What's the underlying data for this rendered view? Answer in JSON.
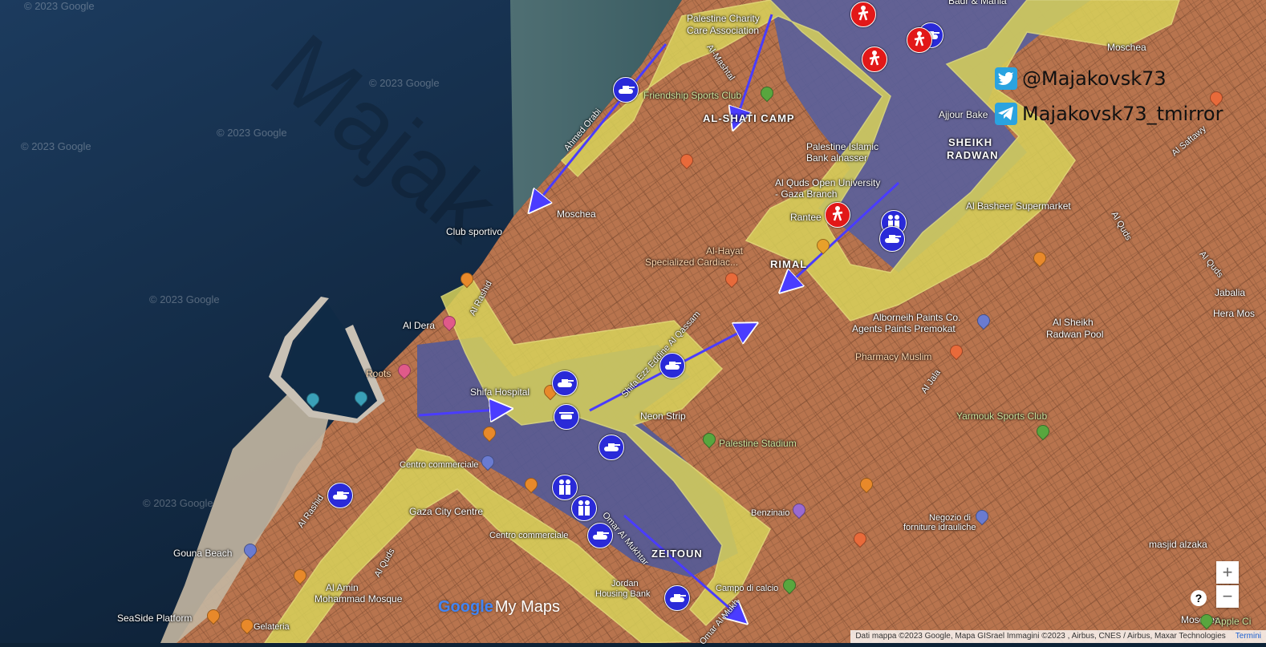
{
  "map": {
    "watermark_text": "© 2023 Google",
    "area_labels": {
      "al_shati_camp": "AL-SHATI CAMP",
      "sheikh_radwan_1": "SHEIKH",
      "sheikh_radwan_2": "RADWAN",
      "rimal": "RIMAL",
      "zeitoun": "ZEITOUN"
    },
    "places": {
      "palestine_charity_1": "Palestine Charity",
      "palestine_charity_2": "Care Association",
      "friendship_sports_club": "Friendship Sports Club",
      "ajjour_bake": "Ajjour Bake",
      "palestine_islamic_1": "Palestine Islamic",
      "palestine_islamic_2": "Bank alnasser",
      "al_quds_open_1": "Al Quds Open University",
      "al_quds_open_2": "- Gaza Branch",
      "rantee": "Rantee",
      "al_basheer": "Al Basheer Supermarket",
      "moschea_1": "Moschea",
      "moschea_2": "Moschea",
      "moschea_3": "Moschea",
      "club_sportivo": "Club sportivo",
      "al_hayat_1": "Al-Hayat",
      "al_hayat_2": "Specialized Cardiac...",
      "al_dera": "Al Dera",
      "roots": "Roots",
      "shifa_hospital": "Shifa Hospital",
      "alborneih_1": "Alborneih Paints Co.",
      "alborneih_2": "Agents Paints Premokat",
      "pharmacy_muslim": "Pharmacy Muslim",
      "al_sheikh_radwan_pool_1": "Al Sheikh",
      "al_sheikh_radwan_pool_2": "Radwan Pool",
      "yarmouk": "Yarmouk Sports Club",
      "neon_strip": "Neon Strip",
      "palestine_stadium": "Palestine Stadium",
      "centro_commerciale_1": "Centro commerciale",
      "centro_commerciale_2": "Centro commerciale",
      "gaza_city_centre": "Gaza City Centre",
      "benzinaio": "Benzinaio",
      "negozio_1": "Negozio di",
      "negozio_2": "forniture idrauliche",
      "masjid_alzaka": "masjid alzaka",
      "gouna_beach": "Gouna Beach",
      "al_amin_1": "Al Amin",
      "al_amin_2": "Mohammad Mosque",
      "jordan_bank_1": "Jordan",
      "jordan_bank_2": "Housing Bank",
      "campo_di_calcio": "Campo di calcio",
      "seaside_platform": "SeaSide Platform",
      "gelateria": "Gelateria",
      "apple_city": "Apple Ci",
      "jabalia": "Jabalia",
      "hera_mos": "Hera Mos",
      "badr_mania": "Badr & Mania"
    },
    "roads": {
      "al_rashid_1": "Al Rashid",
      "al_rashid_2": "Al Rashid",
      "al_quds_1": "Al Quds",
      "al_quds_2": "Al Quds",
      "al_quds_3": "Al Quds",
      "al_saftawy": "Al Saftawy",
      "al_jala": "Al Jala",
      "al_mashtal": "Al-Mashtal",
      "ahmed_orabi": "Ahmed Orabi",
      "shifa_ezzedine": "Shifa Ezz Eddine Al Qassam",
      "omar_mukhtar": "Omar Al Mukhtar",
      "omar_mukhtar_2": "Omar Al Mukh"
    }
  },
  "social": {
    "twitter_handle": "@Majakovsk73",
    "telegram_handle": "Majakovsk73_tmirror",
    "twitter_icon": "twitter-bird-icon",
    "telegram_icon": "telegram-plane-icon"
  },
  "controls": {
    "zoom_in": "+",
    "zoom_out": "−",
    "help": "?"
  },
  "branding": {
    "google": "Google",
    "my_maps": "My Maps"
  },
  "attribution": {
    "text": "Dati mappa ©2023 Google, Mapa GISrael Immagini ©2023 , Airbus, CNES / Airbus, Maxar Technologies",
    "terms": "Termini"
  },
  "colors": {
    "sea": "#0d2236",
    "land_occupied_orange": "#b8744e",
    "contested_yellow": "#d8d25a",
    "held_blue": "#5a5f9a",
    "unit_blue": "#2a2ad8",
    "enemy_red": "#e21818"
  }
}
